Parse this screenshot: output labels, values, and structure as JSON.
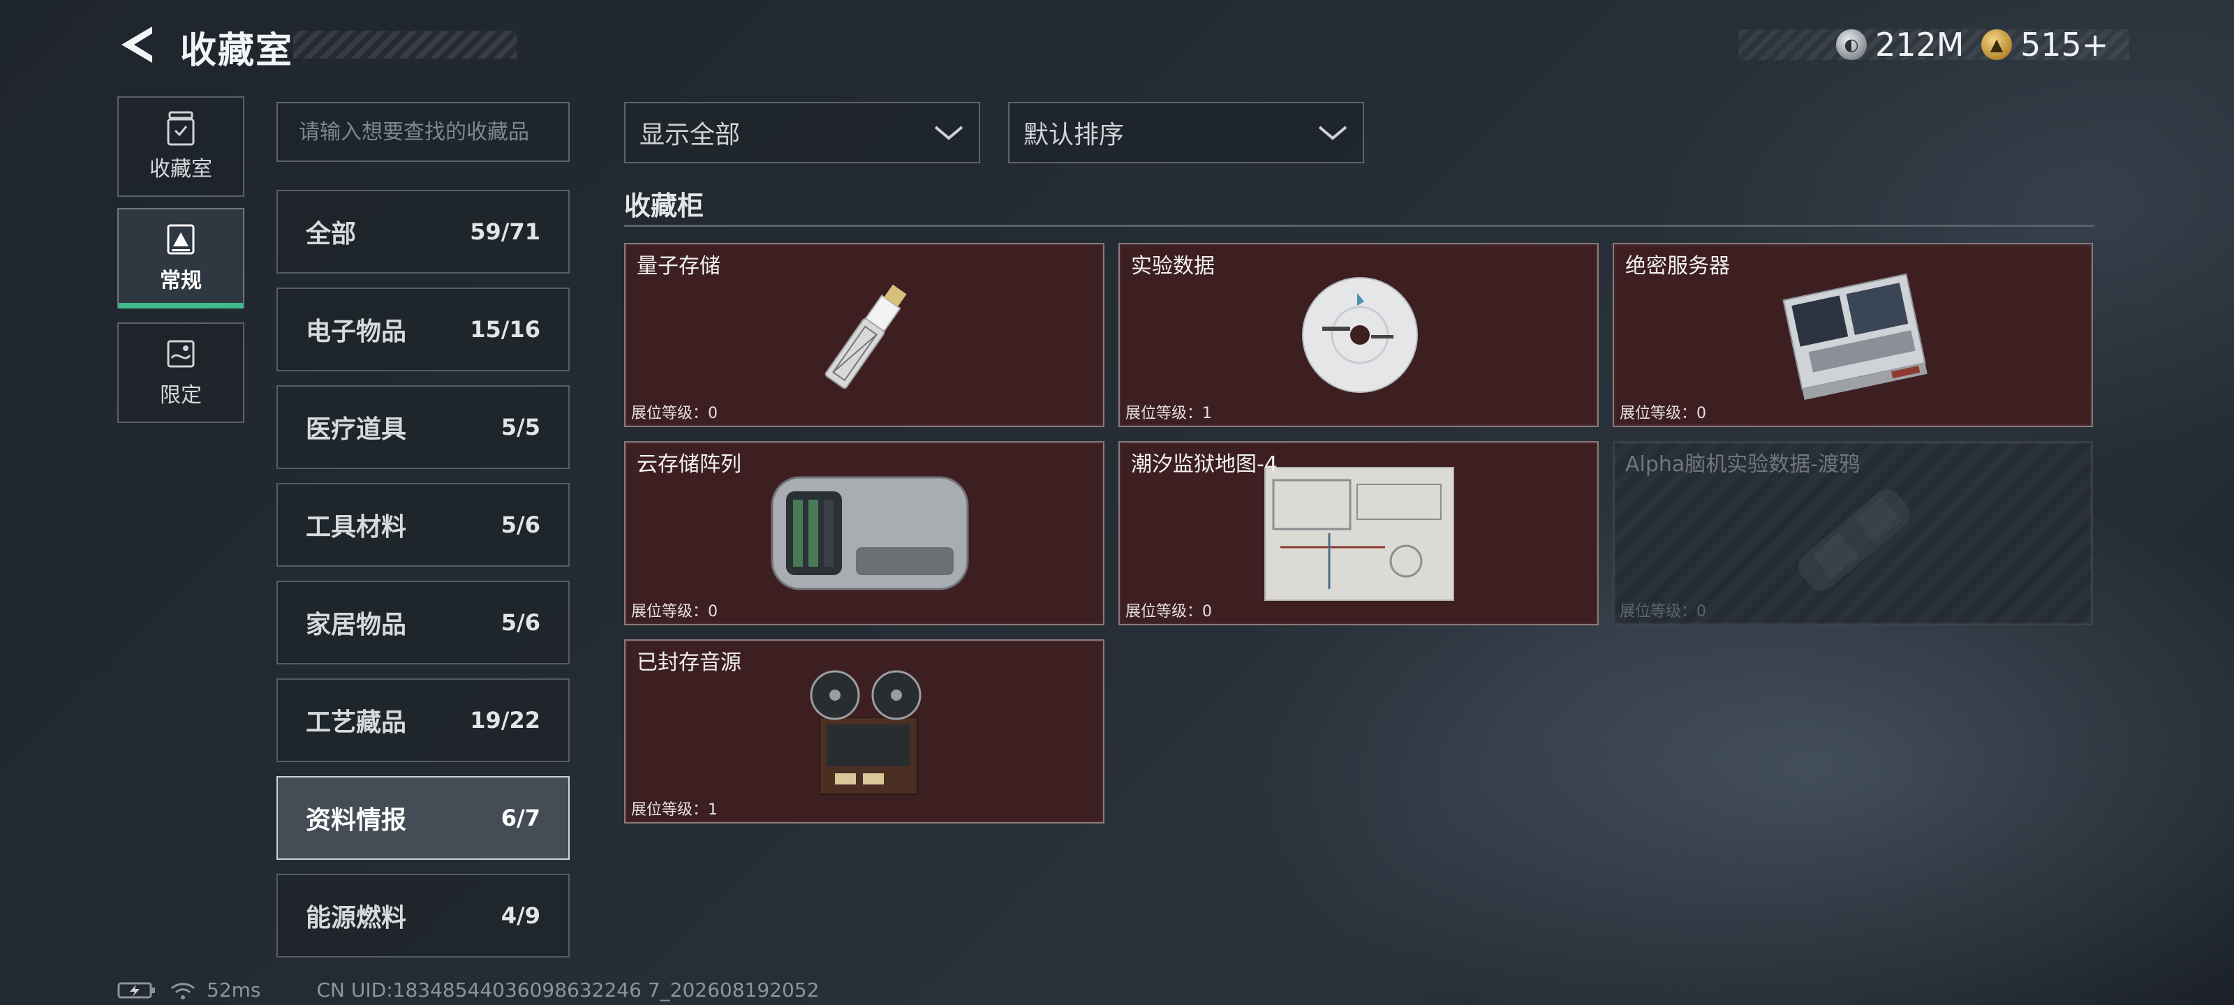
{
  "header": {
    "title": "收藏室",
    "currency": [
      {
        "icon": "silver-coin-icon",
        "value": "212M"
      },
      {
        "icon": "gold-coin-icon",
        "value": "515+"
      }
    ]
  },
  "nav": [
    {
      "label": "收藏室",
      "icon": "collection-room-icon",
      "active": false
    },
    {
      "label": "常规",
      "icon": "regular-icon",
      "active": true
    },
    {
      "label": "限定",
      "icon": "limited-icon",
      "active": false
    }
  ],
  "search": {
    "placeholder": "请输入想要查找的收藏品"
  },
  "categories": [
    {
      "name": "全部",
      "count": "59/71"
    },
    {
      "name": "电子物品",
      "count": "15/16"
    },
    {
      "name": "医疗道具",
      "count": "5/5"
    },
    {
      "name": "工具材料",
      "count": "5/6"
    },
    {
      "name": "家居物品",
      "count": "5/6"
    },
    {
      "name": "工艺藏品",
      "count": "19/22"
    },
    {
      "name": "资料情报",
      "count": "6/7",
      "active": true
    },
    {
      "name": "能源燃料",
      "count": "4/9"
    }
  ],
  "filters": {
    "display": "显示全部",
    "sort": "默认排序"
  },
  "section_title": "收藏柜",
  "items": [
    {
      "name": "量子存储",
      "level": "展位等级：0",
      "art": "usb-drive",
      "locked": false
    },
    {
      "name": "实验数据",
      "level": "展位等级：1",
      "art": "disc",
      "locked": false
    },
    {
      "name": "绝密服务器",
      "level": "展位等级：0",
      "art": "server",
      "locked": false
    },
    {
      "name": "云存储阵列",
      "level": "展位等级：0",
      "art": "storage-array",
      "locked": false
    },
    {
      "name": "潮汐监狱地图-4",
      "level": "展位等级：0",
      "art": "map",
      "locked": false
    },
    {
      "name": "Alpha脑机实验数据-渡鸦",
      "level": "展位等级：0",
      "art": "brain-device",
      "locked": true
    },
    {
      "name": "已封存音源",
      "level": "展位等级：1",
      "art": "tape-recorder",
      "locked": false
    }
  ],
  "footer": {
    "ping": "52ms",
    "uid": "CN UID:18348544036098632246 7_202608192052"
  },
  "colors": {
    "accent": "#3dbb8a",
    "card_bg": "#3d1f22",
    "active_category": "#444c55"
  }
}
